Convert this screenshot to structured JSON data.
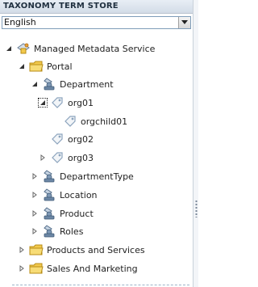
{
  "header": {
    "title": "TAXONOMY TERM STORE"
  },
  "language": {
    "selected": "English"
  },
  "tree": {
    "root": "Managed Metadata Service",
    "group_portal": "Portal",
    "termset_department": "Department",
    "term_org01": "org01",
    "term_orgchild01": "orgchild01",
    "term_org02": "org02",
    "term_org03": "org03",
    "termset_departmenttype": "DepartmentType",
    "termset_location": "Location",
    "termset_product": "Product",
    "termset_roles": "Roles",
    "group_products": "Products and Services",
    "group_sales": "Sales And Marketing"
  },
  "colors": {
    "header_bg": "#d3dce7",
    "folder": "#f2c94c",
    "tag": "#9fb6cc"
  }
}
